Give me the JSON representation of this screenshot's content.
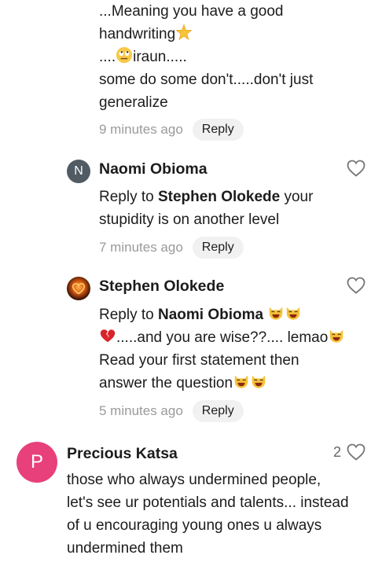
{
  "comment_top": {
    "lines": [
      "...Meaning you have a good",
      "handwriting",
      "....",
      "iraun.....",
      "some do some don't.....don't just",
      "generalize"
    ],
    "time": "9 minutes ago",
    "reply": "Reply"
  },
  "reply_naomi": {
    "avatar_initial": "N",
    "avatar_color": "#505b63",
    "author": "Naomi Obioma",
    "prefix": "Reply to ",
    "mention": "Stephen Olokede",
    "text_a": " your",
    "text_b": "stupidity is on another level",
    "time": "7 minutes ago",
    "reply": "Reply"
  },
  "reply_stephen": {
    "author": "Stephen Olokede",
    "prefix": "Reply to ",
    "mention": "Naomi Obioma",
    "line2": ".....and you are wise??.... lemao",
    "line3": "Read your first statement then",
    "line4": "answer the question",
    "time": "5 minutes ago",
    "reply": "Reply"
  },
  "comment_precious": {
    "avatar_initial": "P",
    "avatar_color": "#e8407a",
    "author": "Precious Katsa",
    "like_count": "2",
    "lines": [
      "those who always undermined people,",
      "let's see ur potentials and talents... instead",
      "of u encouraging young ones u always",
      "undermined them"
    ]
  }
}
